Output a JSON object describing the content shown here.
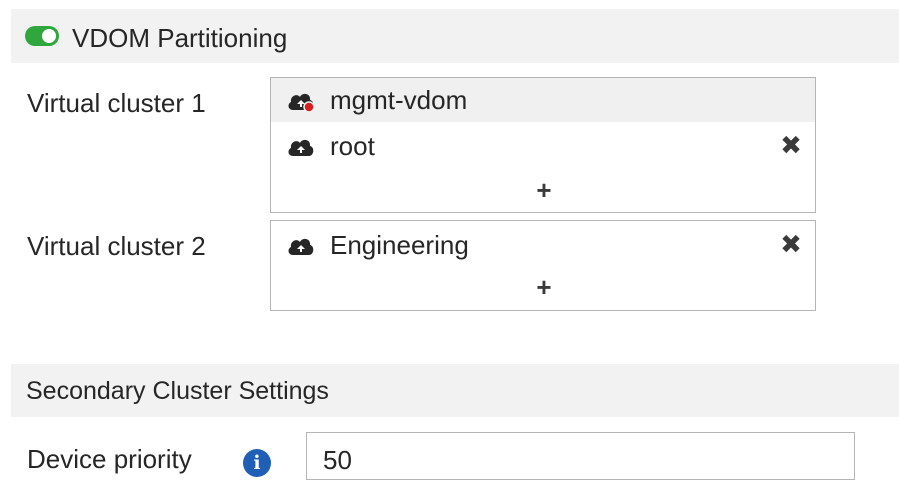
{
  "vdom_partitioning": {
    "title": "VDOM Partitioning",
    "enabled": true,
    "toggle_color": "#2fa73c",
    "clusters": [
      {
        "label": "Virtual cluster 1",
        "items": [
          {
            "name": "mgmt-vdom",
            "icon": "cloud-icon-with-status-dot",
            "removable": false
          },
          {
            "name": "root",
            "icon": "cloud-icon",
            "removable": true
          }
        ],
        "add_label": "+"
      },
      {
        "label": "Virtual cluster 2",
        "items": [
          {
            "name": "Engineering",
            "icon": "cloud-icon",
            "removable": true
          }
        ],
        "add_label": "+"
      }
    ],
    "remove_label": "✖"
  },
  "secondary_cluster": {
    "title": "Secondary Cluster Settings",
    "device_priority_label": "Device priority",
    "device_priority_value": "50",
    "info_icon": "info-icon"
  }
}
